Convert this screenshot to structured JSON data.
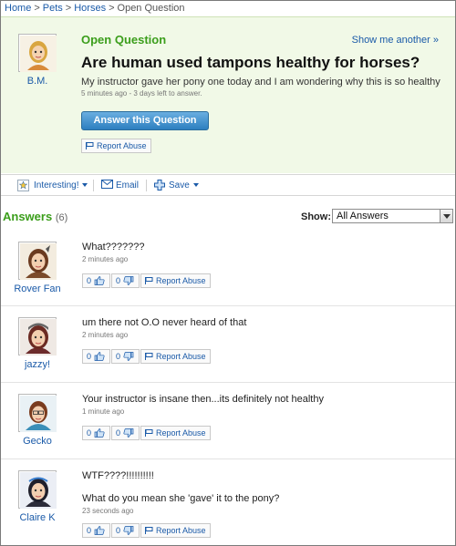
{
  "breadcrumb": {
    "items": [
      "Home",
      "Pets",
      "Horses"
    ],
    "current": "Open Question",
    "separator": ">"
  },
  "question": {
    "label": "Open Question",
    "show_another": "Show me another »",
    "user": "B.M.",
    "title": "Are human used tampons healthy for horses?",
    "body": "My instructor gave her pony one today and I am wondering why this is so healthy",
    "meta": "5 minutes ago - 3 days left to answer.",
    "answer_button": "Answer this Question",
    "report": "Report Abuse"
  },
  "actions": {
    "interesting": "Interesting!",
    "email": "Email",
    "save": "Save"
  },
  "answers": {
    "heading": "Answers",
    "count": "(6)",
    "show_label": "Show:",
    "filter": "All Answers",
    "items": [
      {
        "user": "Rover Fan",
        "text": "What???????",
        "text2": "",
        "time": "2 minutes ago",
        "up": "0",
        "down": "0",
        "report": "Report Abuse"
      },
      {
        "user": "jazzy!",
        "text": "um there not O.O never heard of that",
        "text2": "",
        "time": "2 minutes ago",
        "up": "0",
        "down": "0",
        "report": "Report Abuse"
      },
      {
        "user": "Gecko",
        "text": "Your instructor is insane then...its definitely not healthy",
        "text2": "",
        "time": "1 minute ago",
        "up": "0",
        "down": "0",
        "report": "Report Abuse"
      },
      {
        "user": "Claire K",
        "text": "WTF????!!!!!!!!!!",
        "text2": "What do you mean she 'gave' it to the pony?",
        "time": "23 seconds ago",
        "up": "0",
        "down": "0",
        "report": "Report Abuse"
      }
    ]
  },
  "colors": {
    "green_heading": "#3b9e1b",
    "link_blue": "#1a5aa8",
    "question_bg": "#f1f9e7",
    "button_blue": "#2d7fc0"
  },
  "icons": [
    "star-icon",
    "envelope-icon",
    "plus-icon",
    "flag-icon",
    "thumbs-up-icon",
    "thumbs-down-icon",
    "chevron-down-icon"
  ]
}
